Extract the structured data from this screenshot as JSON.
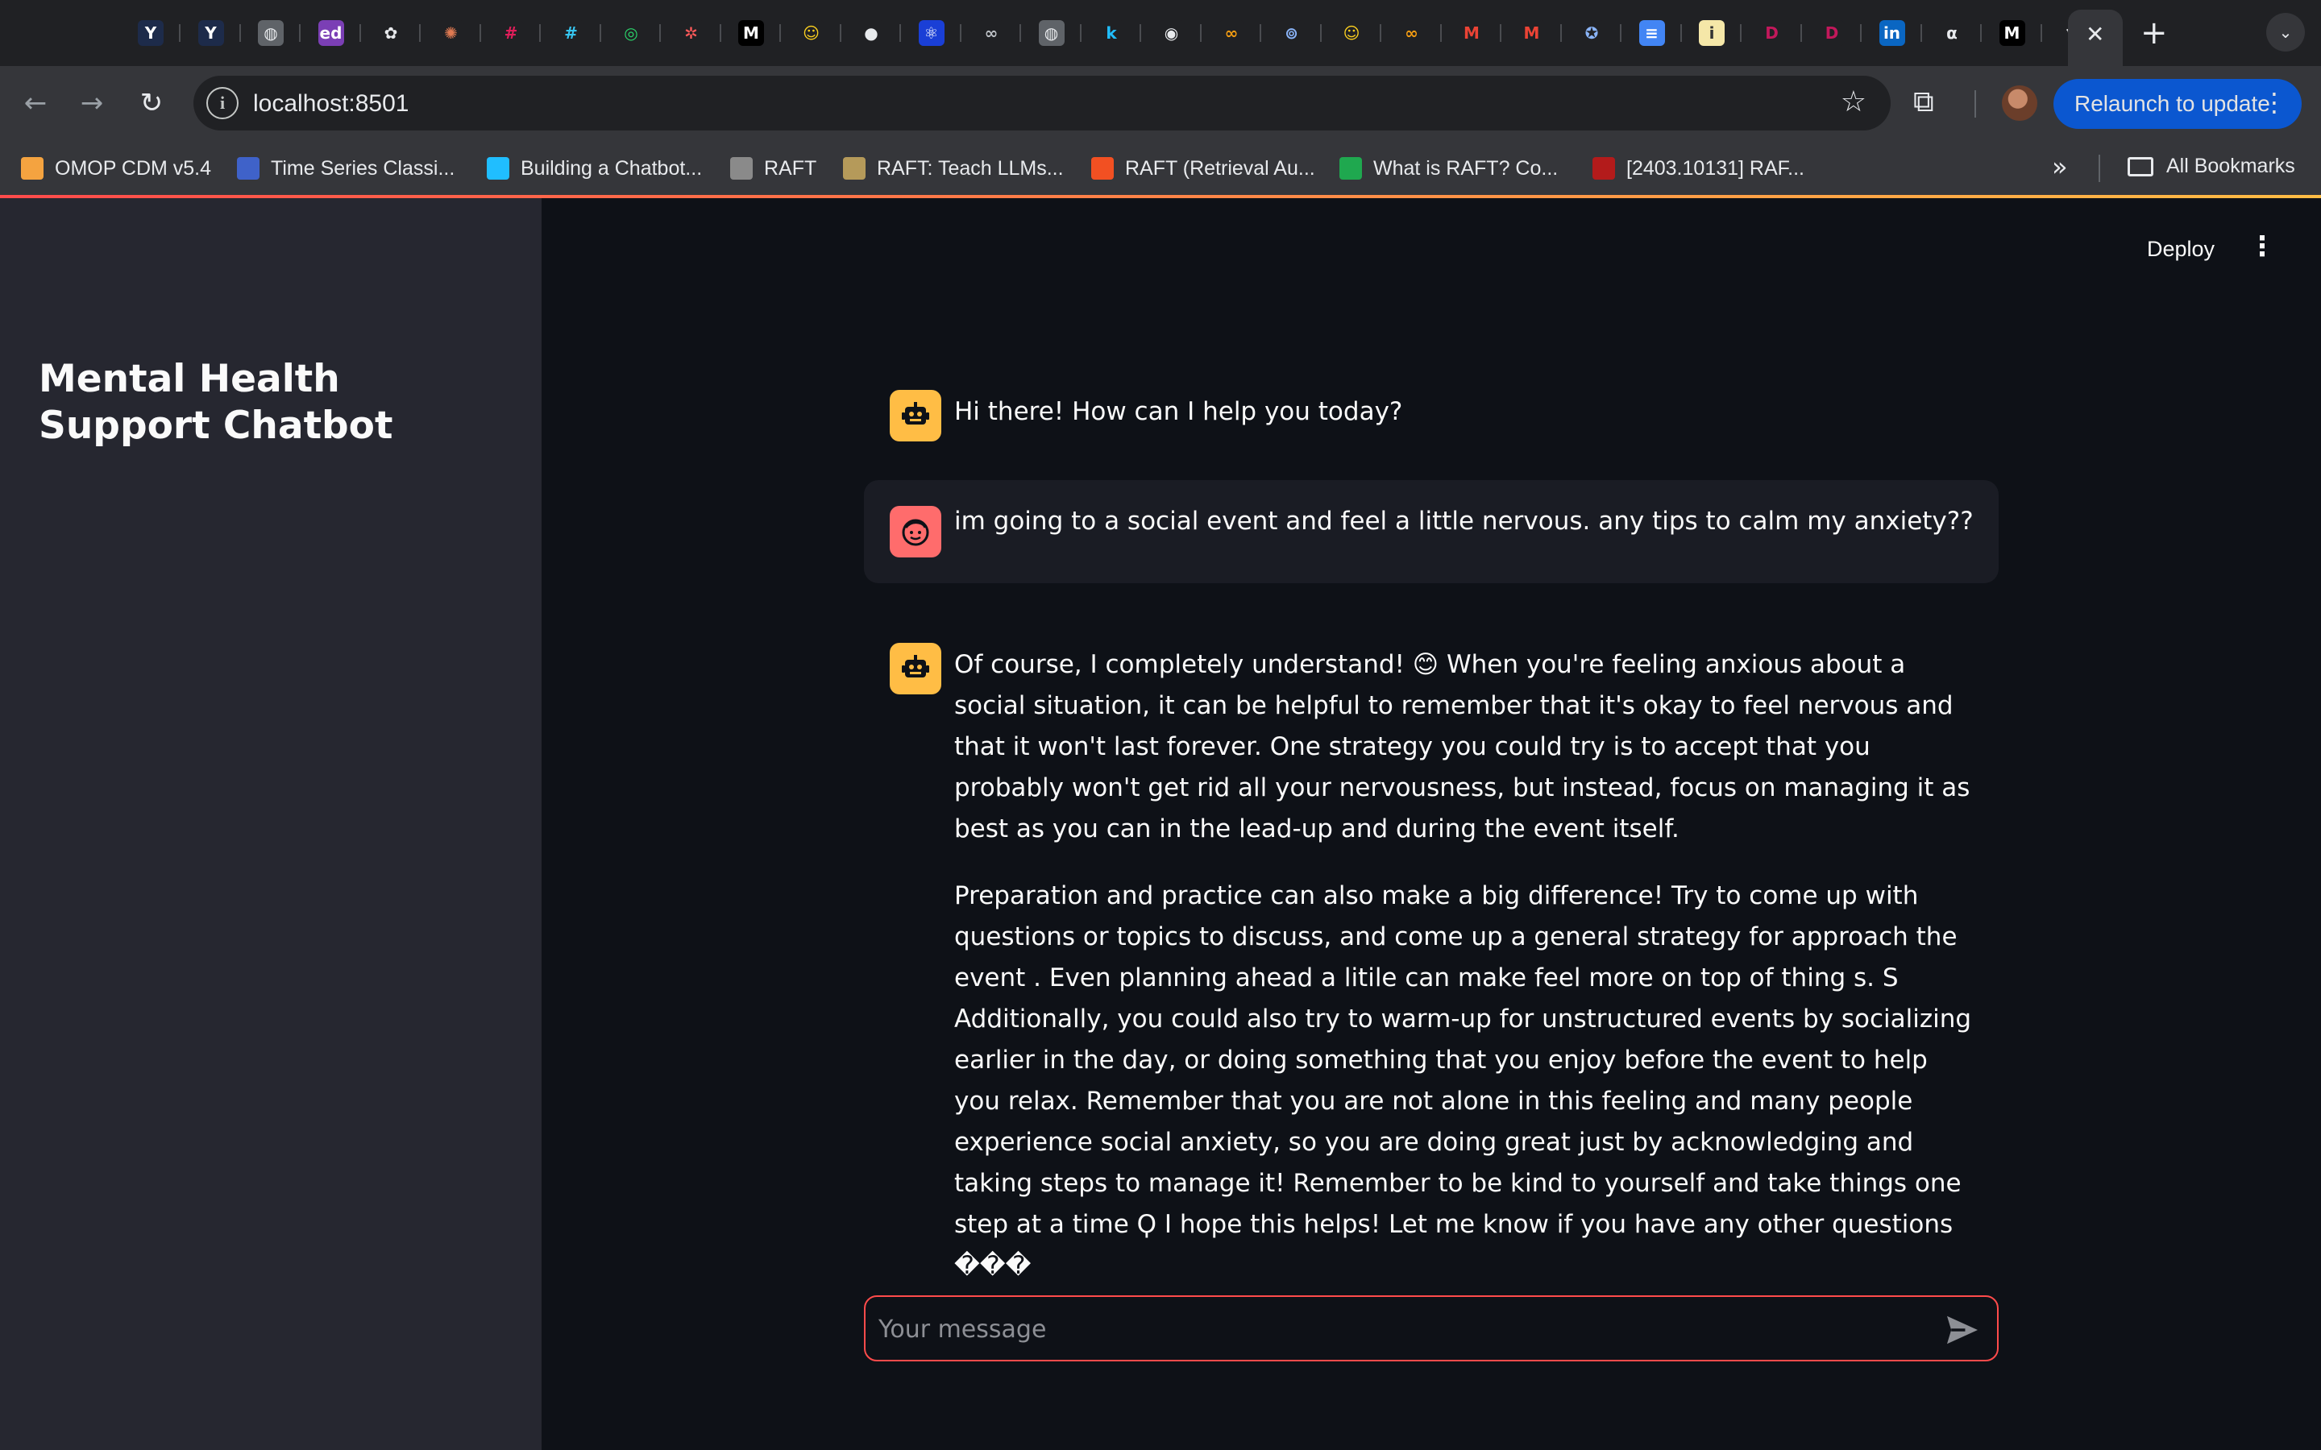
{
  "browser": {
    "tabs": [
      {
        "name": "yc",
        "glyph": "Y",
        "bg": "#1d2b4a",
        "fg": "#ffffff"
      },
      {
        "name": "yc-2",
        "glyph": "Y",
        "bg": "#1d2b4a",
        "fg": "#ffffff"
      },
      {
        "name": "globe",
        "glyph": "◍",
        "bg": "#5f6368",
        "fg": "#e8eaed"
      },
      {
        "name": "edstem",
        "glyph": "ed",
        "bg": "#7b3fb5",
        "fg": "#ffffff"
      },
      {
        "name": "openai",
        "glyph": "✿",
        "bg": "#202124",
        "fg": "#e8eaed"
      },
      {
        "name": "claude",
        "glyph": "✺",
        "bg": "#202124",
        "fg": "#e07a52"
      },
      {
        "name": "slack",
        "glyph": "#",
        "bg": "#202124",
        "fg": "#e01e5a"
      },
      {
        "name": "slack-2",
        "glyph": "#",
        "bg": "#202124",
        "fg": "#36c5f0"
      },
      {
        "name": "app-green",
        "glyph": "◎",
        "bg": "#202124",
        "fg": "#2bd46b"
      },
      {
        "name": "pinwheel",
        "glyph": "✲",
        "bg": "#202124",
        "fg": "#ff5a5a"
      },
      {
        "name": "medium",
        "glyph": "M",
        "bg": "#000000",
        "fg": "#ffffff"
      },
      {
        "name": "huggingface",
        "glyph": "☺",
        "bg": "#202124",
        "fg": "#ffd21e"
      },
      {
        "name": "github",
        "glyph": "●",
        "bg": "#202124",
        "fg": "#e8eaed"
      },
      {
        "name": "react",
        "glyph": "⚛",
        "bg": "#1a3fd6",
        "fg": "#ffffff"
      },
      {
        "name": "infinity",
        "glyph": "∞",
        "bg": "#202124",
        "fg": "#bdc1c6"
      },
      {
        "name": "globe-2",
        "glyph": "◍",
        "bg": "#5f6368",
        "fg": "#e8eaed"
      },
      {
        "name": "kaggle",
        "glyph": "k",
        "bg": "#202124",
        "fg": "#20beff"
      },
      {
        "name": "chatgpt",
        "glyph": "◉",
        "bg": "#202124",
        "fg": "#e8eaed"
      },
      {
        "name": "infinity-orange",
        "glyph": "∞",
        "bg": "#202124",
        "fg": "#f39c12"
      },
      {
        "name": "owl",
        "glyph": "⊚",
        "bg": "#202124",
        "fg": "#8ab4f8"
      },
      {
        "name": "huggingface-2",
        "glyph": "☺",
        "bg": "#202124",
        "fg": "#ffd21e"
      },
      {
        "name": "infinity-orange-2",
        "glyph": "∞",
        "bg": "#202124",
        "fg": "#f39c12"
      },
      {
        "name": "gmail",
        "glyph": "M",
        "bg": "#202124",
        "fg": "#ea4335"
      },
      {
        "name": "gmail-2",
        "glyph": "M",
        "bg": "#202124",
        "fg": "#ea4335"
      },
      {
        "name": "seal",
        "glyph": "✪",
        "bg": "#202124",
        "fg": "#8ab4f8"
      },
      {
        "name": "google-docs",
        "glyph": "≡",
        "bg": "#4285f4",
        "fg": "#ffffff"
      },
      {
        "name": "info",
        "glyph": "i",
        "bg": "#f5e7a8",
        "fg": "#333333"
      },
      {
        "name": "doordash",
        "glyph": "D",
        "bg": "#202124",
        "fg": "#c2185b"
      },
      {
        "name": "doordash-2",
        "glyph": "D",
        "bg": "#202124",
        "fg": "#c2185b"
      },
      {
        "name": "linkedin",
        "glyph": "in",
        "bg": "#0a66c2",
        "fg": "#ffffff"
      },
      {
        "name": "alphaxiv",
        "glyph": "α",
        "bg": "#202124",
        "fg": "#e8eaed"
      },
      {
        "name": "medium-2",
        "glyph": "M",
        "bg": "#000000",
        "fg": "#ffffff"
      },
      {
        "name": "crown",
        "glyph": "♛",
        "bg": "#202124",
        "fg": "#e8eaed"
      }
    ],
    "active_tab_close": "✕",
    "new_tab": "+",
    "url": "localhost:8501",
    "relaunch_label": "Relaunch to update",
    "bookmarks": [
      {
        "label": "OMOP CDM v5.4",
        "color": "#f4a340"
      },
      {
        "label": "Time Series Classi...",
        "color": "#3f62c9"
      },
      {
        "label": "Building a Chatbot...",
        "color": "#20beff"
      },
      {
        "label": "RAFT",
        "color": "#8a8a8a"
      },
      {
        "label": "RAFT: Teach LLMs...",
        "color": "#b59a5a"
      },
      {
        "label": "RAFT (Retrieval Au...",
        "color": "#f25022"
      },
      {
        "label": "What is RAFT? Co...",
        "color": "#1fa84f"
      },
      {
        "label": "[2403.10131] RAF...",
        "color": "#b31b1b"
      }
    ],
    "all_bookmarks_label": "All Bookmarks"
  },
  "sidebar": {
    "title": "Mental Health Support Chatbot"
  },
  "header": {
    "deploy_label": "Deploy"
  },
  "messages": [
    {
      "role": "assistant",
      "paragraphs": [
        "Hi there! How can I help you today?"
      ]
    },
    {
      "role": "user",
      "paragraphs": [
        "im going to a social event and feel a little nervous. any tips to calm my anxiety??"
      ]
    },
    {
      "role": "assistant",
      "paragraphs": [
        "Of course, I completely understand! 😊 When you're feeling anxious about a social situation, it can be helpful to remember that it's okay to feel nervous and that it won't last forever. One strategy you could try is to accept that you probably won't get rid all your nervousness, but instead, focus on managing it as best as you can in the lead-up and during the event itself.",
        "Preparation and practice can also make a big difference! Try to come up with questions or topics to discuss, and come up a general strategy for approach the event . Even planning ahead a litile can make feel more on top of thing s. S Additionally, you could also try to warm-up for unstructured events by socializing earlier in the day, or doing something that you enjoy before the event to help you relax. Remember that you are not alone in this feeling and many people experience social anxiety, so you are doing great just by acknowledging and taking steps to manage it! Remember to be kind to yourself and take things one step at a time Ϙ I hope this helps! Let me know if you have any other questions ���"
      ]
    }
  ],
  "chat_input": {
    "placeholder": "Your message",
    "value": ""
  },
  "colors": {
    "accent": "#ff4b4b",
    "bot_avatar": "#ffbd45",
    "user_avatar": "#ff6c6c",
    "sidebar_bg": "#262730",
    "main_bg": "#0e1117"
  }
}
